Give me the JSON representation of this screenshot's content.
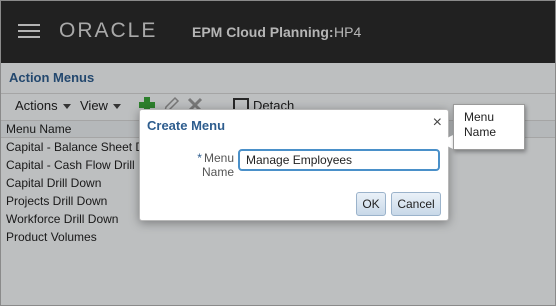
{
  "header": {
    "brand": "ORACLE",
    "app_title": "EPM Cloud Planning:",
    "app_env": "HP4",
    "menu_icon": "hamburger-icon"
  },
  "panel": {
    "title": "Action Menus",
    "toolbar": {
      "actions_label": "Actions",
      "view_label": "View",
      "add_icon": "plus-icon",
      "edit_icon": "pencil-icon",
      "delete_icon": "x-icon",
      "detach_label": "Detach",
      "detach_icon": "detach-icon"
    },
    "column_header": "Menu Name",
    "rows": [
      "Capital - Balance Sheet D",
      "Capital - Cash Flow Drill D",
      "Capital Drill Down",
      "Projects Drill Down",
      "Workforce Drill Down",
      "Product Volumes"
    ]
  },
  "dialog": {
    "title": "Create Menu",
    "close_label": "×",
    "field": {
      "required_marker": "*",
      "label_line1": "Menu",
      "label_line2": "Name",
      "value": "Manage Employees"
    },
    "ok_label": "OK",
    "cancel_label": "Cancel"
  },
  "callout": {
    "line1": "Menu",
    "line2": "Name"
  },
  "colors": {
    "header_bg": "#2b2b2b",
    "accent": "#2e5d8e",
    "focus_border": "#4a90c9",
    "add_green": "#3aa53a"
  }
}
